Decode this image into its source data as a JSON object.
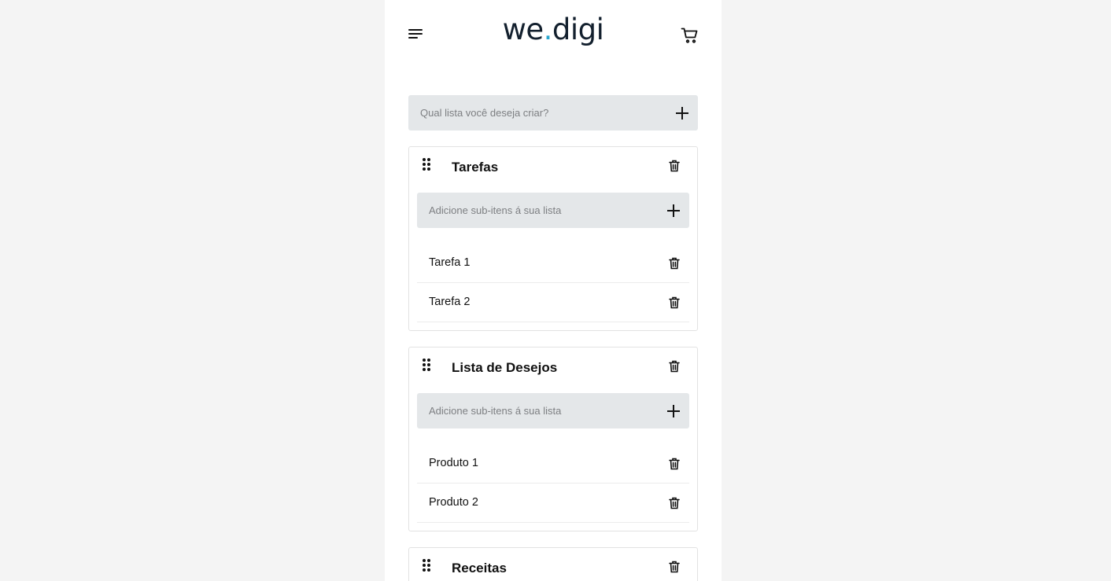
{
  "header": {
    "logo_part1": "we",
    "logo_dot": ".",
    "logo_part2": "digi",
    "menu_icon": "hamburger-menu-icon",
    "cart_icon": "shopping-cart-icon"
  },
  "new_list": {
    "placeholder": "Qual lista você deseja criar?",
    "value": ""
  },
  "lists": [
    {
      "title": "Tarefas",
      "sub_placeholder": "Adicione sub-itens á sua lista",
      "items": [
        "Tarefa 1",
        "Tarefa 2"
      ]
    },
    {
      "title": "Lista de Desejos",
      "sub_placeholder": "Adicione sub-itens á sua lista",
      "items": [
        "Produto 1",
        "Produto 2"
      ]
    },
    {
      "title": "Receitas",
      "sub_placeholder": "",
      "items": []
    }
  ],
  "colors": {
    "page_background": "#f4f4f4",
    "app_background": "#ffffff",
    "input_background": "#e4e7e9",
    "logo_text": "#13202e",
    "logo_dot": "#2aa7cf"
  }
}
